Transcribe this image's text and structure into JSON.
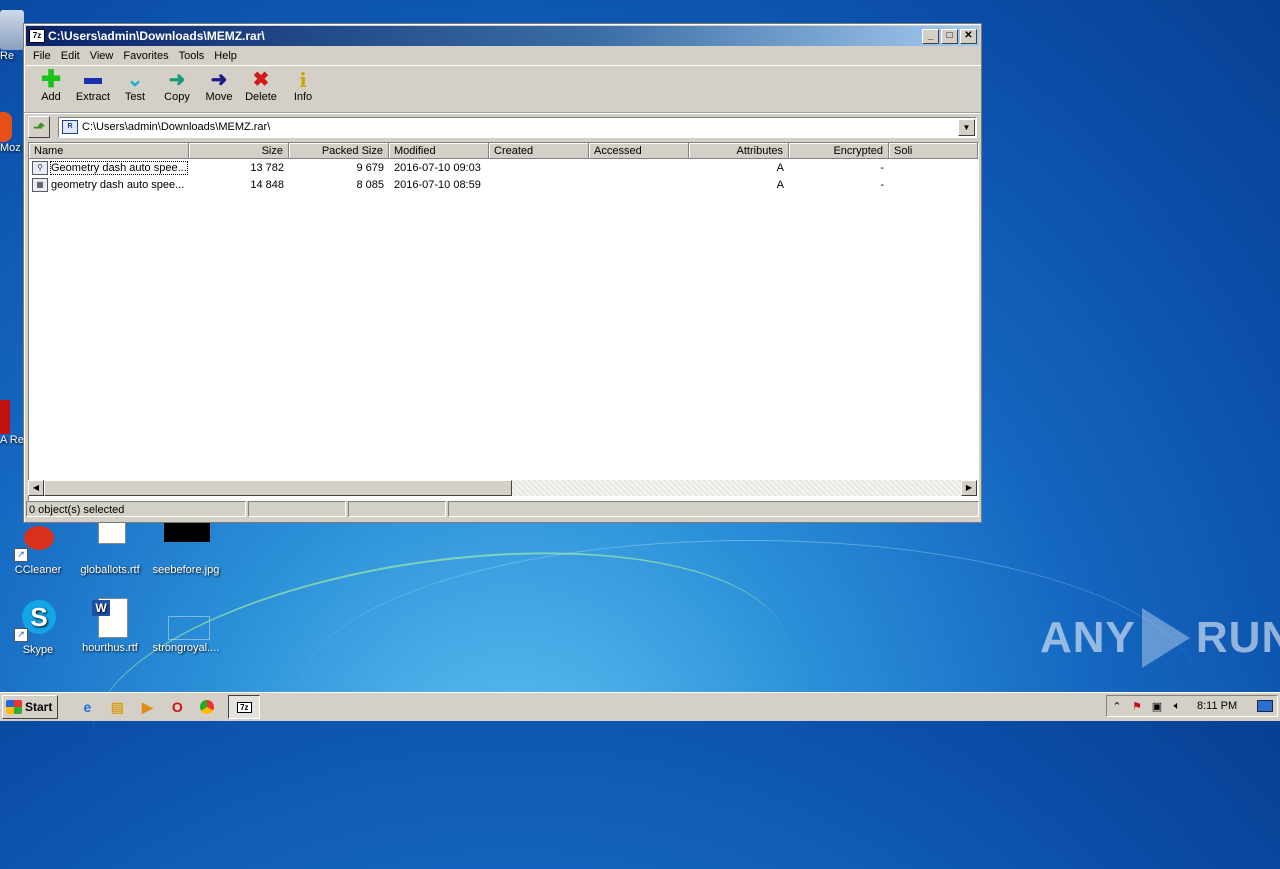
{
  "window": {
    "title": "C:\\Users\\admin\\Downloads\\MEMZ.rar\\",
    "app_icon": "7z",
    "controls": [
      "minimize-icon",
      "maximize-icon",
      "close-icon"
    ]
  },
  "menu": [
    "File",
    "Edit",
    "View",
    "Favorites",
    "Tools",
    "Help"
  ],
  "toolbar": [
    {
      "label": "Add",
      "icon": "plus-icon",
      "color": "#19c419"
    },
    {
      "label": "Extract",
      "icon": "minus-icon",
      "color": "#1a2fb0"
    },
    {
      "label": "Test",
      "icon": "check-chevron-icon",
      "color": "#18b3c8"
    },
    {
      "label": "Copy",
      "icon": "arrow-right-icon",
      "color": "#1a9a7a"
    },
    {
      "label": "Move",
      "icon": "arrow-right-icon",
      "color": "#1a1a8a"
    },
    {
      "label": "Delete",
      "icon": "x-icon",
      "color": "#d41818"
    },
    {
      "label": "Info",
      "icon": "info-icon",
      "color": "#c8a800"
    }
  ],
  "address": {
    "path": "C:\\Users\\admin\\Downloads\\MEMZ.rar\\"
  },
  "columns": [
    "Name",
    "Size",
    "Packed Size",
    "Modified",
    "Created",
    "Accessed",
    "Attributes",
    "Encrypted",
    "Soli"
  ],
  "files": [
    {
      "name": "Geometry dash auto spee...",
      "size": "13 782",
      "packed": "9 679",
      "modified": "2016-07-10 09:03",
      "created": "",
      "accessed": "",
      "attributes": "A",
      "encrypted": "-"
    },
    {
      "name": "geometry dash auto spee...",
      "size": "14 848",
      "packed": "8 085",
      "modified": "2016-07-10 08:59",
      "created": "",
      "accessed": "",
      "attributes": "A",
      "encrypted": "-"
    }
  ],
  "status": {
    "selection": "0 object(s) selected"
  },
  "desktop": {
    "icons": [
      {
        "label": "CCleaner"
      },
      {
        "label": "globallots.rtf"
      },
      {
        "label": "seebefore.jpg"
      },
      {
        "label": "Skype"
      },
      {
        "label": "hourthus.rtf"
      },
      {
        "label": "strongroyal...."
      }
    ],
    "left_edge_labels": [
      "Re",
      "Moz",
      "A Re"
    ]
  },
  "taskbar": {
    "start_label": "Start",
    "quicklaunch": [
      "ie-icon",
      "explorer-icon",
      "media-player-icon",
      "opera-icon",
      "chrome-icon"
    ],
    "active_task_icon": "7z",
    "clock": "8:11 PM"
  },
  "watermark": {
    "left": "ANY",
    "right": "RUN"
  }
}
